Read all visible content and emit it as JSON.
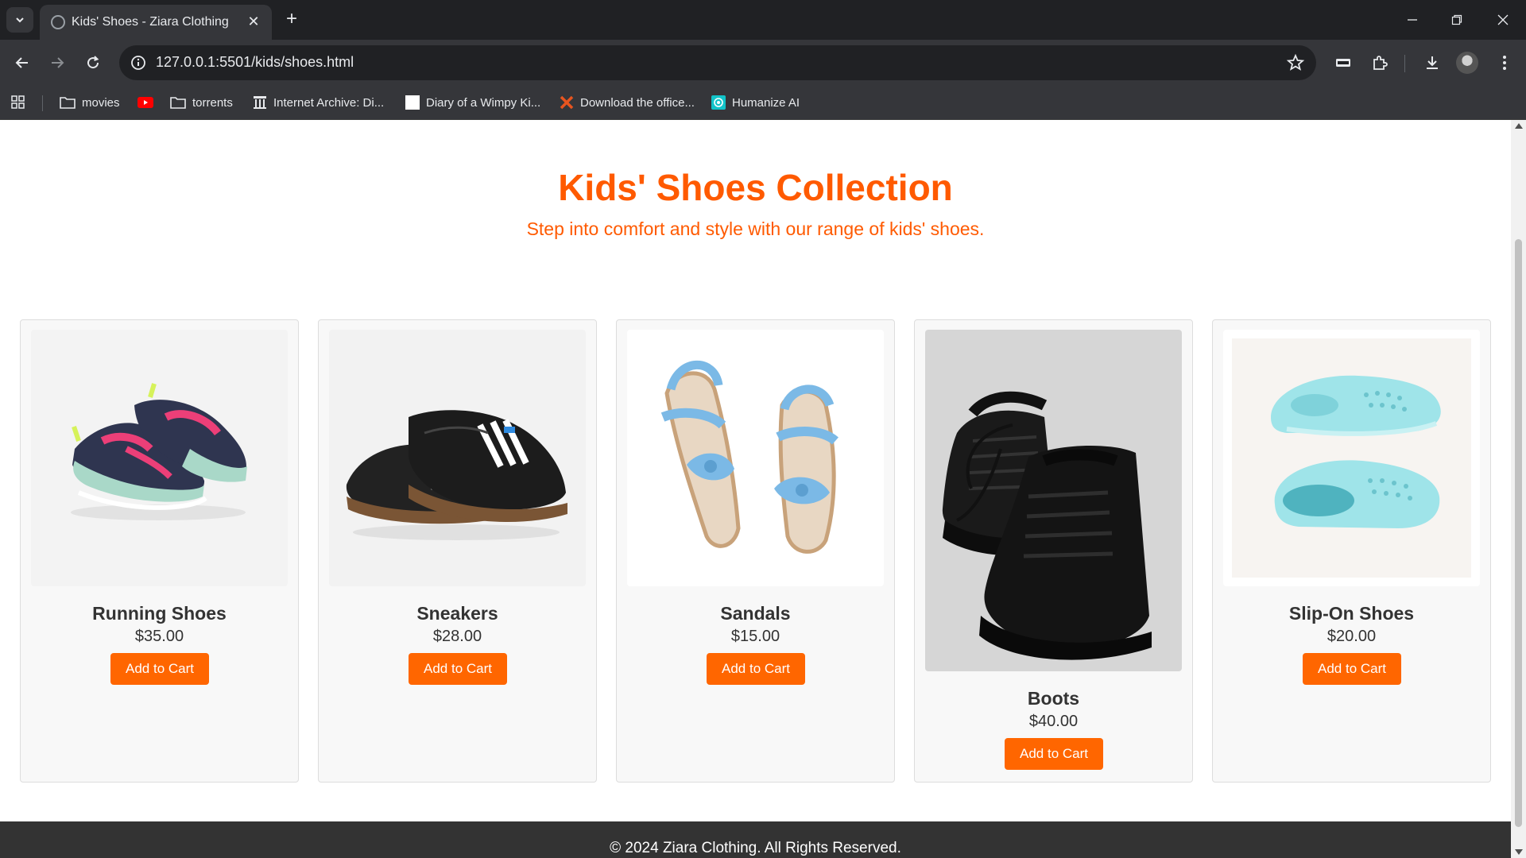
{
  "browser": {
    "tab_title": "Kids' Shoes - Ziara Clothing",
    "url": "127.0.0.1:5501/kids/shoes.html",
    "bookmarks": [
      {
        "label": "movies",
        "icon": "folder-icon"
      },
      {
        "label": "",
        "icon": "youtube-icon"
      },
      {
        "label": "torrents",
        "icon": "folder-icon"
      },
      {
        "label": "Internet Archive: Di...",
        "icon": "archive-icon"
      },
      {
        "label": "Diary of a Wimpy Ki...",
        "icon": "page-icon"
      },
      {
        "label": "Download the office...",
        "icon": "x-logo-icon"
      },
      {
        "label": "Humanize AI",
        "icon": "humanize-icon"
      }
    ]
  },
  "hero": {
    "title": "Kids' Shoes Collection",
    "subtitle": "Step into comfort and style with our range of kids' shoes."
  },
  "products": [
    {
      "name": "Running Shoes",
      "price": "$35.00",
      "button": "Add to Cart"
    },
    {
      "name": "Sneakers",
      "price": "$28.00",
      "button": "Add to Cart"
    },
    {
      "name": "Sandals",
      "price": "$15.00",
      "button": "Add to Cart"
    },
    {
      "name": "Boots",
      "price": "$40.00",
      "button": "Add to Cart"
    },
    {
      "name": "Slip-On Shoes",
      "price": "$20.00",
      "button": "Add to Cart"
    }
  ],
  "footer": {
    "text": "© 2024 Ziara Clothing. All Rights Reserved."
  },
  "colors": {
    "accent": "#ff5a00",
    "button": "#ff6600",
    "footer_bg": "#333333"
  }
}
